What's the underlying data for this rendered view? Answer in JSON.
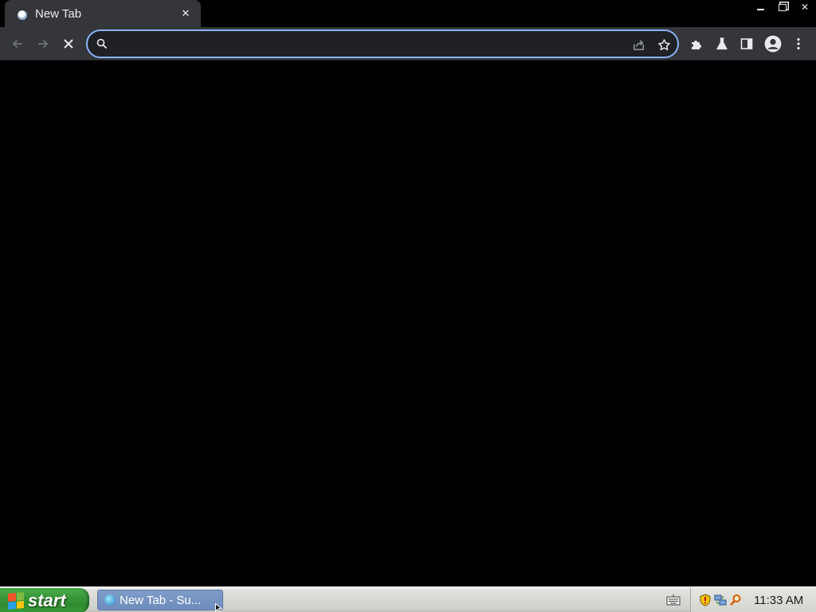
{
  "browser": {
    "tab": {
      "title": "New Tab"
    },
    "omnibox": {
      "value": "",
      "placeholder": ""
    },
    "accent": "#8ab4f8"
  },
  "icons": {
    "tab_favicon": "new-tab-favicon",
    "back": "arrow-left",
    "forward": "arrow-right",
    "stop": "x-mark",
    "search": "magnifier",
    "share": "share-arrow",
    "bookmark": "star-outline",
    "extensions": "puzzle-piece",
    "labs": "flask",
    "side_panel": "side-panel",
    "profile": "person-circle",
    "menu": "three-dots-vertical"
  },
  "window_controls": {
    "close": "✕"
  },
  "taskbar": {
    "start_label": "start",
    "task": {
      "label": "New Tab - Su..."
    },
    "clock": "11:33 AM",
    "start_color": "#3c9b3c"
  }
}
